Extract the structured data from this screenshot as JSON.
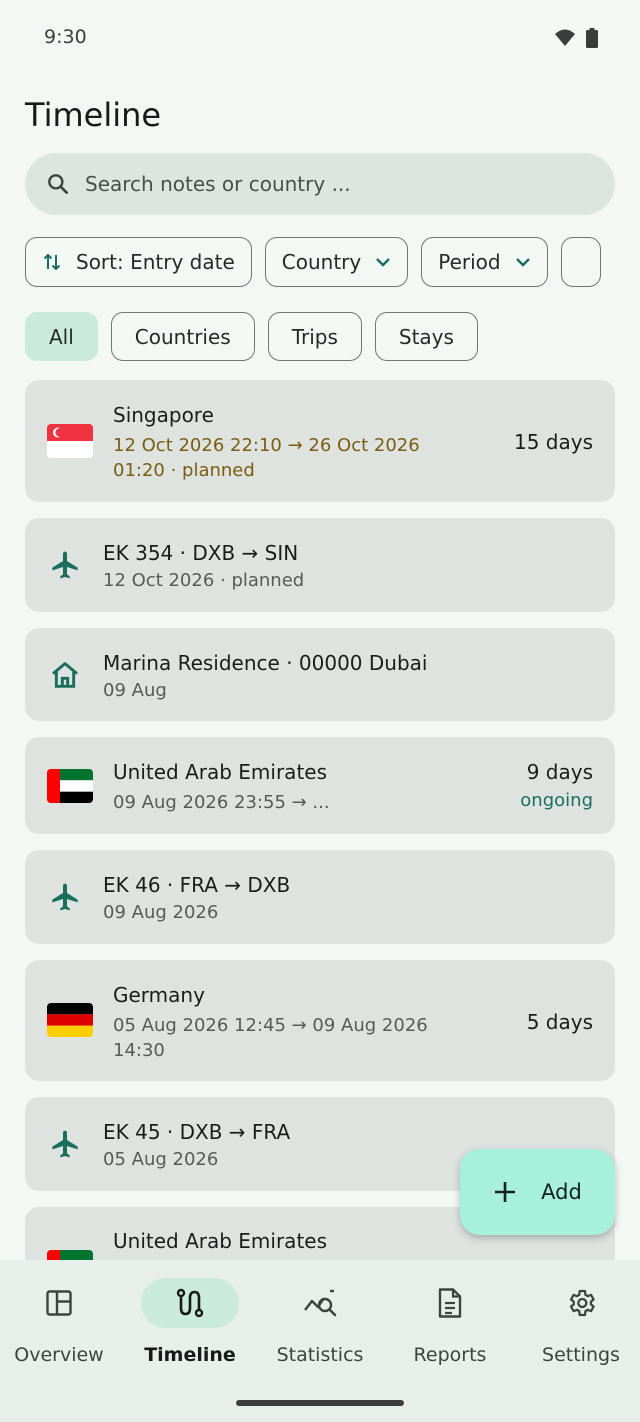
{
  "status": {
    "time": "9:30"
  },
  "header": {
    "title": "Timeline"
  },
  "search": {
    "placeholder": "Search notes or country ..."
  },
  "filters": {
    "sort_label": "Sort: Entry date",
    "country_label": "Country",
    "period_label": "Period"
  },
  "type_chips": [
    "All",
    "Countries",
    "Trips",
    "Stays"
  ],
  "type_selected": "All",
  "timeline": [
    {
      "kind": "country",
      "flag": "singapore-flag",
      "title": "Singapore",
      "line1": "12 Oct 2026 22:10  →  26 Oct 2026",
      "line2": "01:20 · planned",
      "days": "15 days"
    },
    {
      "kind": "flight",
      "icon": "airplane-icon",
      "title": "EK 354 · DXB → SIN",
      "sub": "12 Oct 2026 · planned"
    },
    {
      "kind": "stay",
      "icon": "house-icon",
      "title": "Marina Residence · 00000 Dubai",
      "sub": "09 Aug"
    },
    {
      "kind": "country",
      "flag": "uae-flag",
      "title": "United Arab Emirates",
      "line1": "09 Aug 2026 23:55  →  ...",
      "days": "9 days",
      "status": "ongoing"
    },
    {
      "kind": "flight",
      "icon": "airplane-icon",
      "title": "EK 46 · FRA → DXB",
      "sub": "09 Aug 2026"
    },
    {
      "kind": "country",
      "flag": "germany-flag",
      "title": "Germany",
      "line1": "05 Aug 2026 12:45  →  09 Aug 2026",
      "line2": "14:30",
      "days": "5 days"
    },
    {
      "kind": "flight",
      "icon": "airplane-icon",
      "title": "EK 45 · DXB → FRA",
      "sub": "05 Aug 2026"
    },
    {
      "kind": "country",
      "flag": "uae-flag",
      "title": "United Arab Emirates"
    }
  ],
  "fab": {
    "label": "Add"
  },
  "nav": [
    {
      "label": "Overview",
      "icon": "overview-icon"
    },
    {
      "label": "Timeline",
      "icon": "timeline-icon",
      "active": true
    },
    {
      "label": "Statistics",
      "icon": "statistics-icon"
    },
    {
      "label": "Reports",
      "icon": "reports-icon"
    },
    {
      "label": "Settings",
      "icon": "settings-icon"
    }
  ],
  "colors": {
    "accent": "#1a6f5c",
    "planned": "#7a5c12",
    "fab": "#a6f0dc",
    "selected_chip": "#c9eadc"
  }
}
